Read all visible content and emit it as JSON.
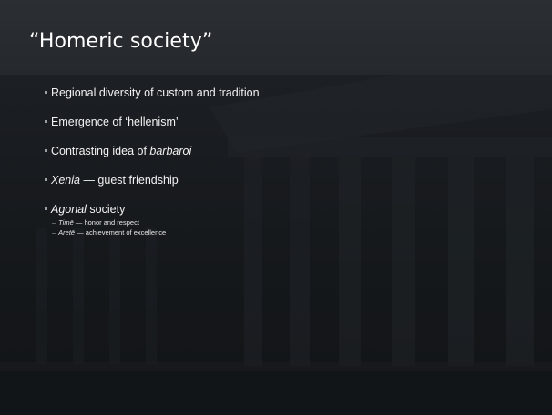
{
  "slide": {
    "title": "“Homeric society”",
    "bullets": [
      {
        "text": "Regional diversity of custom and tradition"
      },
      {
        "text": "Emergence of ‘hellenism’"
      },
      {
        "prefix": "Contrasting idea of ",
        "italic": "barbaroi"
      },
      {
        "italic": "Xenia",
        "suffix": " — guest friendship"
      },
      {
        "italic": "Agonal",
        "suffix": " society"
      }
    ],
    "subbullets": [
      {
        "dash": "–",
        "italic": "Timē",
        "suffix": " — honor and respect"
      },
      {
        "dash": "–",
        "italic": "Aretē",
        "suffix": " — achievement of excellence"
      }
    ]
  },
  "colors": {
    "background": "#15181b",
    "title_bar": "#282c30",
    "text": "#ffffff",
    "bullet_marker": "#9aa1a8"
  }
}
